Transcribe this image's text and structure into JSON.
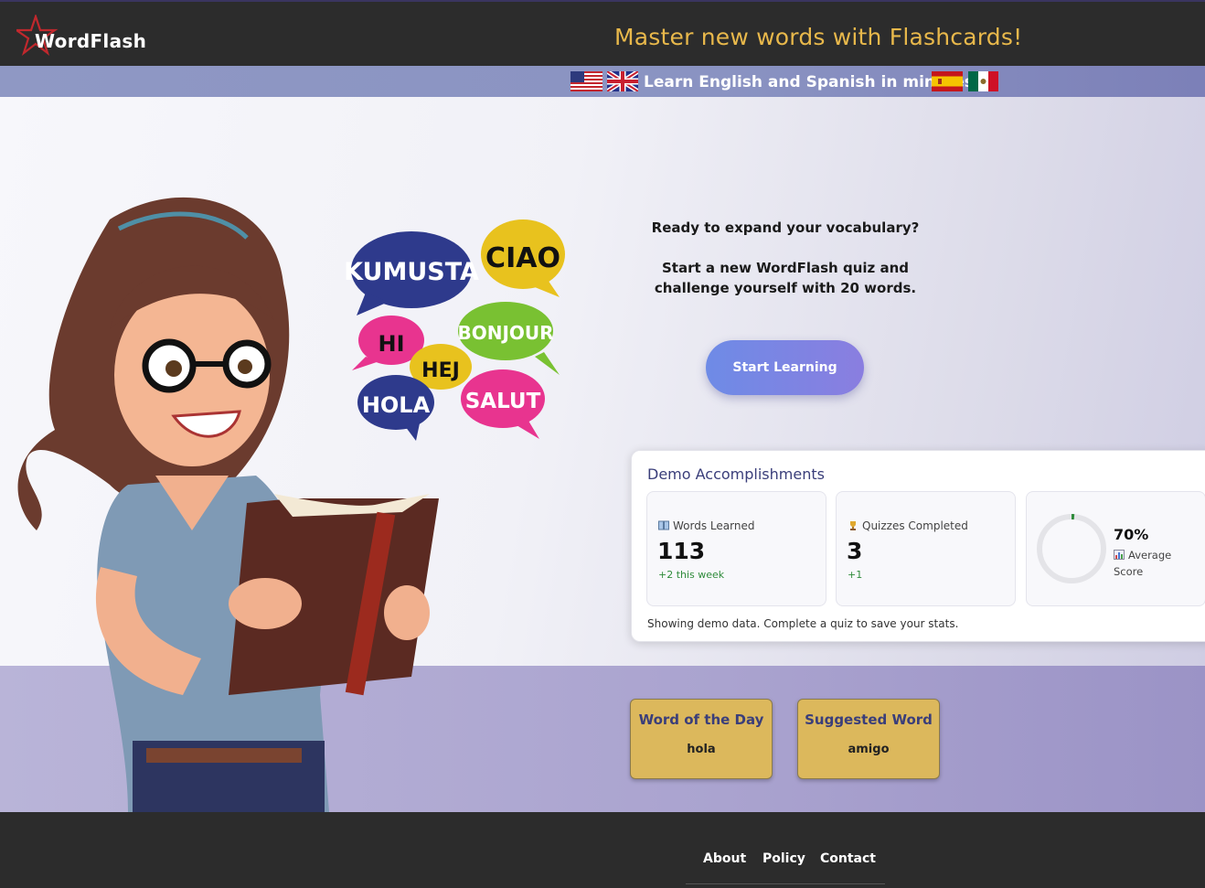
{
  "header": {
    "logo_text": "WordFlash",
    "tagline": "Master new words with Flashcards!"
  },
  "banner": {
    "text": "Learn English and Spanish in minutes!",
    "flags": [
      "us-flag-icon",
      "uk-flag-icon",
      "spain-flag-icon",
      "mexico-flag-icon"
    ]
  },
  "illustration": {
    "bubbles": [
      "KUMUSTA",
      "CIAO",
      "HI",
      "BONJOUR",
      "HEJ",
      "HOLA",
      "SALUT"
    ]
  },
  "hero": {
    "line1": "Ready to expand your vocabulary?",
    "line2": "Start a new WordFlash quiz and",
    "line3": "challenge yourself with 20 words.",
    "start_button": "Start Learning"
  },
  "accomplishments": {
    "title": "Demo Accomplishments",
    "words_learned": {
      "label": "Words Learned",
      "value": "113",
      "delta": "+2 this week",
      "icon": "book-icon"
    },
    "quizzes_completed": {
      "label": "Quizzes Completed",
      "value": "3",
      "delta": "+1",
      "icon": "trophy-icon"
    },
    "average_score": {
      "value": "70%",
      "label": "Average Score",
      "fraction": 0.7,
      "icon": "bar-chart-icon"
    },
    "note": "Showing demo data. Complete a quiz to save your stats."
  },
  "word_of_day": {
    "title": "Word of the Day",
    "word": "hola"
  },
  "suggested_word": {
    "title": "Suggested Word",
    "word": "amigo"
  },
  "footer": {
    "links": [
      "About",
      "Policy",
      "Contact"
    ]
  },
  "colors": {
    "accent_gold": "#e8b84b",
    "card_gold": "#dcb85c",
    "header_dark": "#2c2c2c",
    "title_indigo": "#3a3e7a",
    "positive_green": "#2e8b3a"
  }
}
